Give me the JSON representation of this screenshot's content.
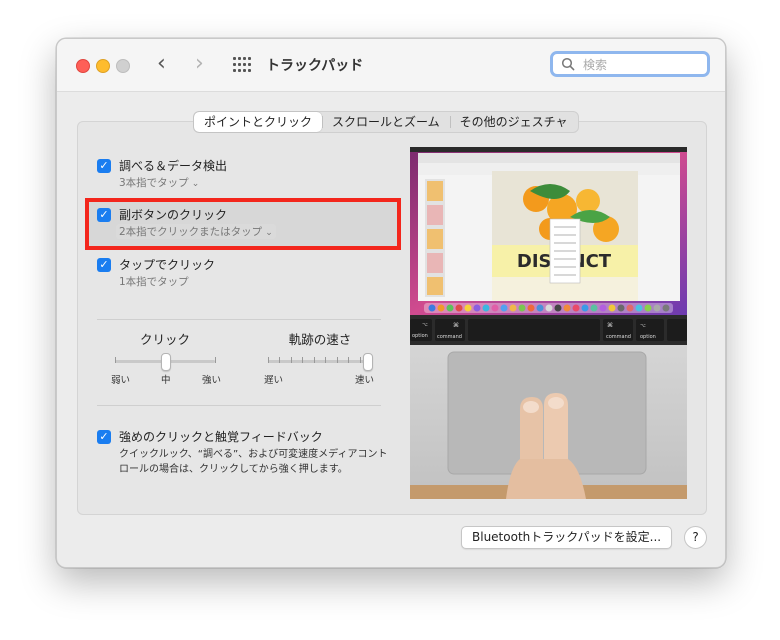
{
  "window": {
    "title": "トラックパッド",
    "search_placeholder": "検索"
  },
  "tabs": [
    {
      "label": "ポイントとクリック",
      "active": true
    },
    {
      "label": "スクロールとズーム",
      "active": false
    },
    {
      "label": "その他のジェスチャ",
      "active": false
    }
  ],
  "options": [
    {
      "label": "調べる＆データ検出",
      "sub": "3本指でタップ",
      "checked": true,
      "has_popup": true
    },
    {
      "label": "副ボタンのクリック",
      "sub": "2本指でクリックまたはタップ",
      "checked": true,
      "has_popup": true,
      "highlighted": true
    },
    {
      "label": "タップでクリック",
      "sub": "1本指でタップ",
      "checked": true,
      "has_popup": false
    }
  ],
  "sliders": {
    "click": {
      "title": "クリック",
      "labels": [
        "弱い",
        "中",
        "強い"
      ],
      "value": "中"
    },
    "speed": {
      "title": "軌跡の速さ",
      "labels": [
        "遅い",
        "速い"
      ],
      "value_fraction": 1.0
    }
  },
  "force_click": {
    "label": "強めのクリックと触覚フィードバック",
    "checked": true,
    "description": "クイックルック、“調べる”、および可変速度メディアコントロールの場合は、クリックしてから強く押します。"
  },
  "preview": {
    "headline": "DISTINCT",
    "keys": {
      "left_symbol": "⌘",
      "left_label": "command",
      "right_symbol": "⌘",
      "right_label": "command",
      "alt_label": "option",
      "alt_symbol": "⌥",
      "fn_symbol": "⌥"
    }
  },
  "buttons": {
    "bluetooth": "Bluetoothトラックパッドを設定...",
    "help": "?"
  },
  "colors": {
    "accent": "#1a7df0",
    "highlight_border": "#f3261c",
    "close": "#fe5f57",
    "minimize": "#febc2e"
  }
}
